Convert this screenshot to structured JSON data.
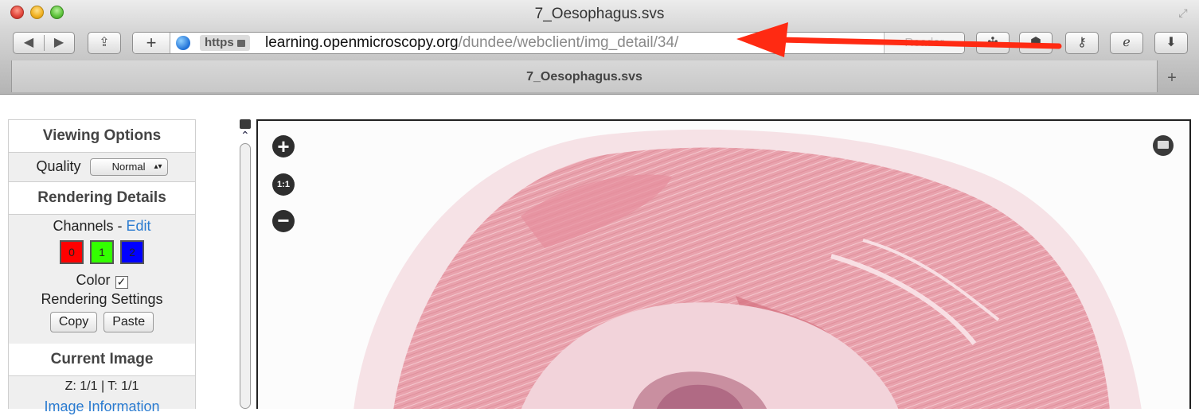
{
  "window": {
    "title": "7_Oesophagus.svs"
  },
  "toolbar": {
    "url_protocol": "https",
    "url_host": "learning.openmicroscopy.org",
    "url_path": "/dundee/webclient/img_detail/34/",
    "reader_label": "Reader"
  },
  "tab": {
    "title": "7_Oesophagus.svs"
  },
  "panel": {
    "viewing_options": "Viewing Options",
    "quality_label": "Quality",
    "quality_value": "Normal",
    "rendering_details": "Rendering Details",
    "channels_label": "Channels - ",
    "edit_link": "Edit",
    "channels": [
      "0",
      "1",
      "2"
    ],
    "color_label": "Color",
    "rendering_settings": "Rendering Settings",
    "copy_button": "Copy",
    "paste_button": "Paste",
    "current_image": "Current Image",
    "z_t_status": "Z: 1/1 | T: 1/1",
    "image_information": "Image Information"
  },
  "viewer": {
    "zoom_one_to_one": "1:1"
  },
  "colors": {
    "tissue": "#e8a0ab",
    "annotation_arrow": "#ff2a12",
    "link": "#2a7bd0"
  }
}
